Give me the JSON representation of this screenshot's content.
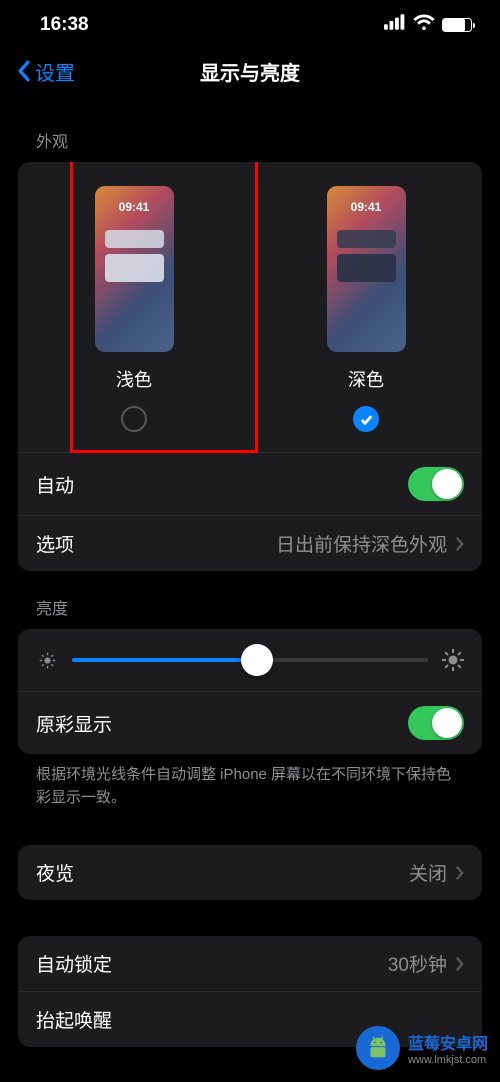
{
  "status": {
    "time": "16:38"
  },
  "nav": {
    "back": "设置",
    "title": "显示与亮度"
  },
  "appearance": {
    "header": "外观",
    "preview_time": "09:41",
    "light": {
      "label": "浅色",
      "selected": false
    },
    "dark": {
      "label": "深色",
      "selected": true
    },
    "auto": {
      "label": "自动",
      "on": true
    },
    "options": {
      "label": "选项",
      "value": "日出前保持深色外观"
    }
  },
  "brightness": {
    "header": "亮度",
    "value_pct": 52,
    "true_tone": {
      "label": "原彩显示",
      "on": true
    },
    "help": "根据环境光线条件自动调整 iPhone 屏幕以在不同环境下保持色彩显示一致。"
  },
  "night_shift": {
    "label": "夜览",
    "value": "关闭"
  },
  "auto_lock": {
    "label": "自动锁定",
    "value": "30秒钟"
  },
  "raise_to_wake": {
    "label": "抬起唤醒"
  },
  "watermark": {
    "title": "蓝莓安卓网",
    "url": "www.lmkjst.com"
  }
}
